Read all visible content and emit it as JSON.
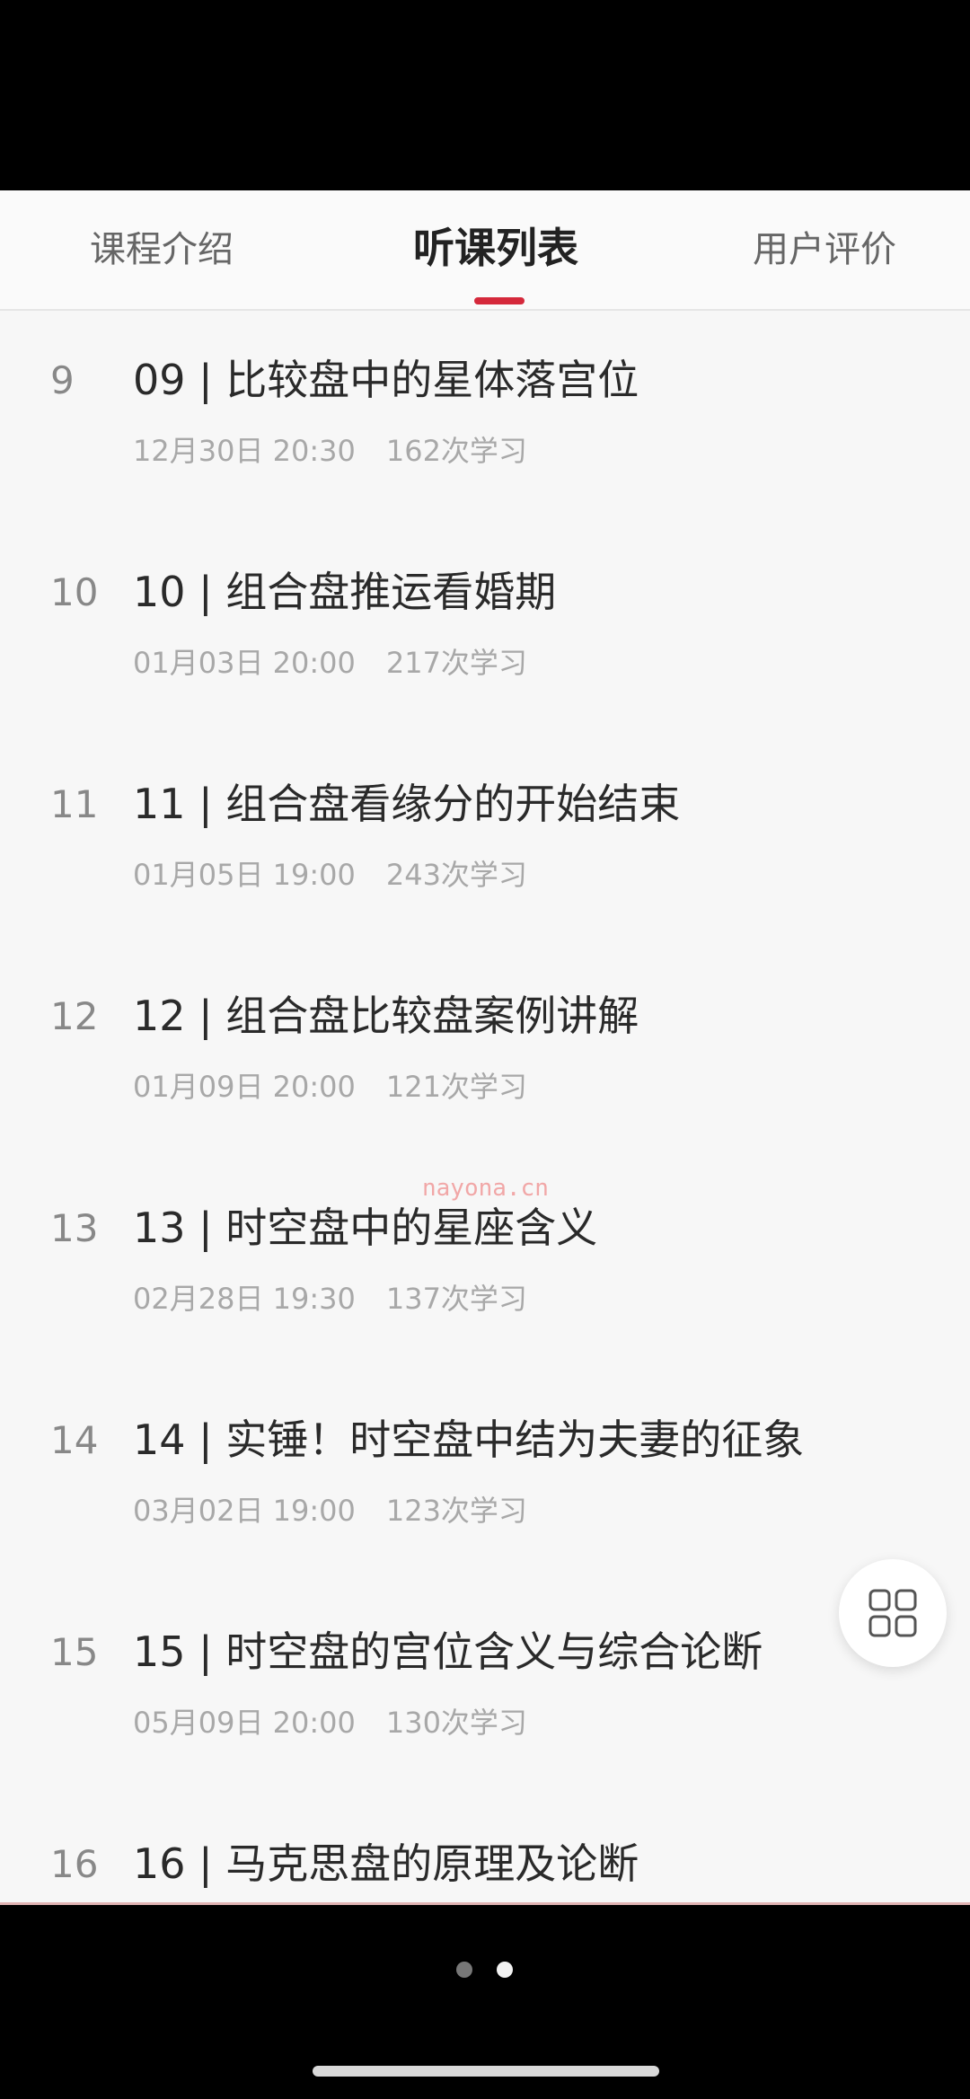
{
  "tabs": [
    {
      "label": "课程介绍",
      "active": false
    },
    {
      "label": "听课列表",
      "active": true
    },
    {
      "label": "用户评价",
      "active": false
    }
  ],
  "lessons": [
    {
      "index": "9",
      "title": "09 | 比较盘中的星体落宫位",
      "date": "12月30日 20:30",
      "count": "162次学习"
    },
    {
      "index": "10",
      "title": "10 | 组合盘推运看婚期",
      "date": "01月03日 20:00",
      "count": "217次学习"
    },
    {
      "index": "11",
      "title": "11 | 组合盘看缘分的开始结束",
      "date": "01月05日 19:00",
      "count": "243次学习"
    },
    {
      "index": "12",
      "title": "12 | 组合盘比较盘案例讲解",
      "date": "01月09日 20:00",
      "count": "121次学习"
    },
    {
      "index": "13",
      "title": "13 | 时空盘中的星座含义",
      "date": "02月28日 19:30",
      "count": "137次学习"
    },
    {
      "index": "14",
      "title": "14 | 实锤！时空盘中结为夫妻的征象",
      "date": "03月02日 19:00",
      "count": "123次学习"
    },
    {
      "index": "15",
      "title": "15 | 时空盘的宫位含义与综合论断",
      "date": "05月09日 20:00",
      "count": "130次学习"
    },
    {
      "index": "16",
      "title": "16 | 马克思盘的原理及论断",
      "date": "",
      "count": ""
    }
  ],
  "watermark": "nayona.cn",
  "float_menu_icon": "grid-icon",
  "colors": {
    "accent": "#d5293b",
    "background": "#f7f7f7"
  },
  "pager": {
    "total": 2,
    "current": 2
  }
}
